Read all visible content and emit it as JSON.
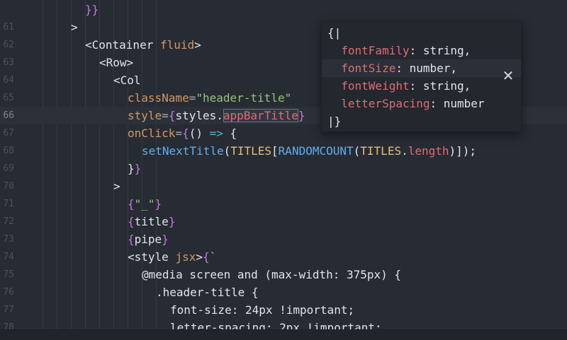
{
  "editor": {
    "lines": [
      {
        "num": "",
        "indent": 120,
        "tokens": [
          {
            "c": "t-br",
            "t": "}"
          },
          {
            "c": "t-br",
            "t": "}"
          }
        ]
      },
      {
        "num": "61",
        "indent": 100,
        "tokens": [
          {
            "c": "t-tag",
            "t": ">"
          }
        ]
      },
      {
        "num": "62",
        "indent": 120,
        "tokens": [
          {
            "c": "t-tag",
            "t": "<Container "
          },
          {
            "c": "t-attr",
            "t": "fluid"
          },
          {
            "c": "t-tag",
            "t": ">"
          }
        ]
      },
      {
        "num": "63",
        "indent": 140,
        "tokens": [
          {
            "c": "t-tag",
            "t": "<Row>"
          }
        ]
      },
      {
        "num": "64",
        "indent": 160,
        "tokens": [
          {
            "c": "t-tag",
            "t": "<Col"
          }
        ]
      },
      {
        "num": "65",
        "indent": 180,
        "tokens": [
          {
            "c": "t-attr",
            "t": "className"
          },
          {
            "c": "t-punc",
            "t": "="
          },
          {
            "c": "t-str",
            "t": "\"header-title\""
          }
        ]
      },
      {
        "num": "66",
        "indent": 180,
        "active": true,
        "tokens": [
          {
            "c": "t-attr",
            "t": "style"
          },
          {
            "c": "t-punc",
            "t": "="
          },
          {
            "c": "t-br",
            "t": "{"
          },
          {
            "c": "t-tag",
            "t": "styles."
          },
          {
            "c": "t-sel",
            "t": "appBarTitle"
          },
          {
            "c": "t-br",
            "t": "}"
          }
        ]
      },
      {
        "num": "67",
        "indent": 180,
        "tokens": [
          {
            "c": "t-attr",
            "t": "onClick"
          },
          {
            "c": "t-punc",
            "t": "="
          },
          {
            "c": "t-br",
            "t": "{"
          },
          {
            "c": "t-tag",
            "t": "() "
          },
          {
            "c": "t-op",
            "t": "=>"
          },
          {
            "c": "t-tag",
            "t": " {"
          }
        ]
      },
      {
        "num": "68",
        "indent": 200,
        "tokens": [
          {
            "c": "t-fn",
            "t": "setNextTitle"
          },
          {
            "c": "t-tag",
            "t": "("
          },
          {
            "c": "t-const",
            "t": "TITLES"
          },
          {
            "c": "t-tag",
            "t": "["
          },
          {
            "c": "t-fn",
            "t": "RANDOMCOUNT"
          },
          {
            "c": "t-tag",
            "t": "("
          },
          {
            "c": "t-const",
            "t": "TITLES"
          },
          {
            "c": "t-tag",
            "t": "."
          },
          {
            "c": "t-prop",
            "t": "length"
          },
          {
            "c": "t-tag",
            "t": ")]);"
          }
        ]
      },
      {
        "num": "69",
        "indent": 180,
        "tokens": [
          {
            "c": "t-tag",
            "t": "}"
          },
          {
            "c": "t-br",
            "t": "}"
          }
        ]
      },
      {
        "num": "70",
        "indent": 160,
        "tokens": [
          {
            "c": "t-tag",
            "t": ">"
          }
        ]
      },
      {
        "num": "71",
        "indent": 180,
        "tokens": [
          {
            "c": "t-br",
            "t": "{"
          },
          {
            "c": "t-str",
            "t": "\"_\""
          },
          {
            "c": "t-br",
            "t": "}"
          }
        ]
      },
      {
        "num": "72",
        "indent": 180,
        "tokens": [
          {
            "c": "t-br",
            "t": "{"
          },
          {
            "c": "t-tag",
            "t": "title"
          },
          {
            "c": "t-br",
            "t": "}"
          }
        ]
      },
      {
        "num": "73",
        "indent": 180,
        "tokens": [
          {
            "c": "t-br",
            "t": "{"
          },
          {
            "c": "t-tag",
            "t": "pipe"
          },
          {
            "c": "t-br",
            "t": "}"
          }
        ]
      },
      {
        "num": "74",
        "indent": 180,
        "tokens": [
          {
            "c": "t-tag",
            "t": "<style "
          },
          {
            "c": "t-attr",
            "t": "jsx"
          },
          {
            "c": "t-tag",
            "t": ">"
          },
          {
            "c": "t-br",
            "t": "{"
          },
          {
            "c": "t-str",
            "t": "`"
          }
        ]
      },
      {
        "num": "75",
        "indent": 200,
        "tokens": [
          {
            "c": "t-tag",
            "t": "@media screen and (max-width: 375px) {"
          }
        ]
      },
      {
        "num": "76",
        "indent": 220,
        "tokens": [
          {
            "c": "t-tag",
            "t": ".header-title {"
          }
        ]
      },
      {
        "num": "77",
        "indent": 240,
        "tokens": [
          {
            "c": "t-tag",
            "t": "font-size: 24px !important;"
          }
        ]
      },
      {
        "num": "78",
        "indent": 240,
        "tokens": [
          {
            "c": "t-tag",
            "t": "letter-spacing: 2px !important;"
          }
        ]
      }
    ]
  },
  "tooltip": {
    "lines": [
      {
        "tokens": [
          {
            "c": "tt-type",
            "t": "{|"
          }
        ]
      },
      {
        "tokens": [
          {
            "c": "tt-key",
            "t": "  fontFamily"
          },
          {
            "c": "tt-type",
            "t": ": string,"
          }
        ]
      },
      {
        "hl": true,
        "tokens": [
          {
            "c": "tt-key",
            "t": "  fontSize"
          },
          {
            "c": "tt-type",
            "t": ": number,"
          }
        ]
      },
      {
        "tokens": [
          {
            "c": "tt-key",
            "t": "  fontWeight"
          },
          {
            "c": "tt-type",
            "t": ": string,"
          }
        ]
      },
      {
        "tokens": [
          {
            "c": "tt-key",
            "t": "  letterSpacing"
          },
          {
            "c": "tt-type",
            "t": ": number"
          }
        ]
      },
      {
        "tokens": [
          {
            "c": "tt-type",
            "t": "|}"
          }
        ]
      }
    ],
    "close_icon": "close-icon",
    "close_glyph": "✕"
  }
}
